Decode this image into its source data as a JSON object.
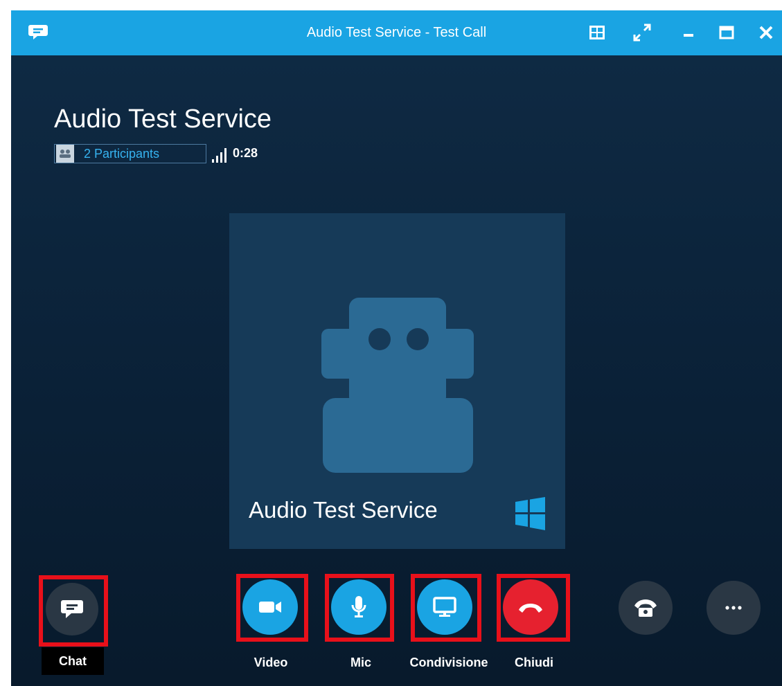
{
  "window": {
    "title": "Audio Test Service - Test Call",
    "app_icon": "chat-bubble-icon",
    "controls": [
      "layout-icon",
      "fullscreen-icon",
      "minimize-icon",
      "maximize-icon",
      "close-icon"
    ]
  },
  "call": {
    "contact_name": "Audio Test Service",
    "participants_label": "2 Participants",
    "duration": "0:28",
    "tile_name": "Audio Test Service"
  },
  "controls": {
    "chat_label": "Chat",
    "video_label": "Video",
    "mic_label": "Mic",
    "share_label": "Condivisione",
    "hangup_label": "Chiudi"
  },
  "colors": {
    "titlebar": "#1aa4e3",
    "accent_blue": "#1aa4e3",
    "hangup_red": "#e6212f",
    "highlight_frame": "#e8101a",
    "dark_button": "#2a3744"
  }
}
